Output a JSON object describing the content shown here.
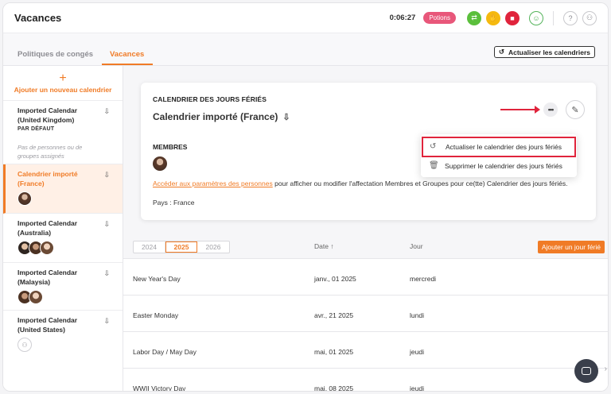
{
  "app": {
    "title": "Vacances"
  },
  "header": {
    "timer": "0:06:27",
    "potions_label": "Potions"
  },
  "tabs": [
    {
      "label": "Politiques de congés"
    },
    {
      "label": "Vacances"
    }
  ],
  "toolbar": {
    "refresh_calendars_label": "Actualiser les calendriers"
  },
  "sidebar": {
    "add_label": "Ajouter un nouveau calendrier",
    "calendars": [
      {
        "name": "Imported Calendar (United Kingdom)",
        "sub": "PAR DÉFAUT",
        "empty": "Pas de personnes ou de groupes assignés"
      },
      {
        "name": "Calendrier importé (France)"
      },
      {
        "name": "Imported Calendar (Australia)"
      },
      {
        "name": "Imported Calendar (Malaysia)"
      },
      {
        "name": "Imported Calendar (United States)"
      }
    ]
  },
  "card": {
    "kicker": "CALENDRIER DES JOURS FÉRIÉS",
    "title": "Calendrier importé (France)",
    "members_label": "MEMBRES",
    "info_link": "Accéder aux paramètres des personnes",
    "info_text": " pour afficher ou modifier l'affectation Membres et Groupes pour ce(tte) Calendrier des jours fériés.",
    "country": "Pays : France",
    "more_label": "•••"
  },
  "dropdown": {
    "items": [
      {
        "label": "Actualiser le calendrier des jours fériés"
      },
      {
        "label": "Supprimer le calendrier des jours fériés"
      }
    ]
  },
  "table": {
    "years": [
      "2024",
      "2025",
      "2026"
    ],
    "selected_year": "2025",
    "col_date": "Date ↑",
    "col_day": "Jour",
    "add_label": "Ajouter un jour férié",
    "rows": [
      {
        "name": "New Year's Day",
        "date": "janv., 01 2025",
        "day": "mercredi"
      },
      {
        "name": "Easter Monday",
        "date": "avr., 21 2025",
        "day": "lundi"
      },
      {
        "name": "Labor Day / May Day",
        "date": "mai, 01 2025",
        "day": "jeudi"
      },
      {
        "name": "WWII Victory Day",
        "date": "mai, 08 2025",
        "day": "jeudi"
      }
    ]
  }
}
